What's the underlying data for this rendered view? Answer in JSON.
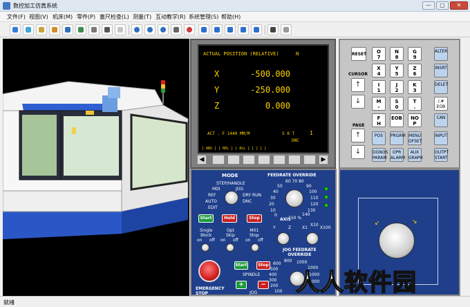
{
  "window": {
    "title": "数控加工仿真系统",
    "min": "—",
    "max": "□",
    "close": "✕"
  },
  "menu": [
    "文件(F)",
    "视图(V)",
    "机床(M)",
    "零件(P)",
    "塞尺检查(L)",
    "测量(T)",
    "互动教学(R)",
    "系统管理(S)",
    "帮助(H)"
  ],
  "toolbar_icons": [
    "select-icon",
    "eraser-icon",
    "machine-icon",
    "workpiece-icon",
    "clamp-icon",
    "tool-icon",
    "measure-icon",
    "chip-icon",
    "edit-icon",
    "rotate-icon",
    "zoom-in-icon",
    "zoom-out-icon",
    "zoom-fit-icon",
    "pan-icon",
    "rotate-view-icon",
    "view-front-icon",
    "view-top-icon",
    "view-left-icon",
    "view-right-icon",
    "view-iso-icon",
    "panel-icon",
    "reset-icon"
  ],
  "crt": {
    "header": "ACTUAL  POSITION (RELATIVE)",
    "mode": "N",
    "axes": [
      {
        "axis": "X",
        "value": "-500.000"
      },
      {
        "axis": "Y",
        "value": "-250.000"
      },
      {
        "axis": "Z",
        "value": "0.000"
      }
    ],
    "act_line": "ACT . F 1440  MM/M",
    "sot": "S   0   T",
    "tool_num": "1",
    "status": "DNC",
    "softkeys": "[ ABS ]  [ REL ]  [ ALL ]  [    ]   [    ]"
  },
  "keypad": {
    "reset": "RESET",
    "cursor": "CURSOR",
    "page": "PAGE",
    "alpha_keys": [
      "O\n7",
      "N\n8",
      "G\n9",
      "X\n4",
      "Y\n5",
      "Z\n6",
      "I\n1",
      "J\n2",
      "K\n3",
      "M\n-",
      "S\n0",
      "T\n.",
      "F\nH",
      "EOB",
      "NO\nP"
    ],
    "right_keys": [
      "ALTER",
      "INSRT",
      "DELET",
      "/,#\nEOB",
      "CAN",
      "INPUT",
      "OUTPT\nSTART"
    ],
    "func_keys": [
      "POS",
      "PRGRM",
      "MENU\nOFSET",
      "DGNOS\nPARAM",
      "OPR\nALARM",
      "AUX\nGRAPH"
    ]
  },
  "panel": {
    "mode_title": "MODE",
    "mode_labels": [
      "STEP/HANDLE",
      "MDI",
      "JOG",
      "REF",
      "DRY RUN",
      "AUTO",
      "DNC",
      "EDIT"
    ],
    "feedrate_title": "FEEDRATE OVERRIDE",
    "feedrate_scale": [
      "60 70 80",
      "50",
      "90",
      "40",
      "100",
      "30",
      "110",
      "20",
      "120",
      "10",
      "0",
      "130",
      "140",
      "150 %"
    ],
    "start": "Start",
    "hold": "Hold",
    "stop": "Stop",
    "single_block": "Single\nBlock",
    "opt_skip": "Opt\nSkip",
    "m01_stop": "M01\nStop",
    "on": "on",
    "off": "off",
    "axis_title": "AXIS",
    "axis_labels": [
      "Y",
      "Z",
      "X1",
      "X10",
      "X100"
    ],
    "jog_title": "JOG FEEDRATE\nOVERRIDE",
    "jog_scale": [
      "600",
      "800",
      "1000",
      "500",
      "400",
      "1000",
      "300",
      "200",
      "1000",
      "100",
      "1000"
    ],
    "spindle": "SPINDLE",
    "spindle_start": "Start",
    "spindle_stop": "Stop",
    "plus": "+",
    "minus": "−",
    "jog_label": "JOG",
    "emergency": "EMERGENCY\nSTOP"
  },
  "status_text": "就绪",
  "watermark": "人人软件园",
  "colors": {
    "crt_text": "#ffd400",
    "panel_bg": "#1f3f8a",
    "start_green": "#1a9a3a",
    "hold_red": "#c81e1e"
  }
}
